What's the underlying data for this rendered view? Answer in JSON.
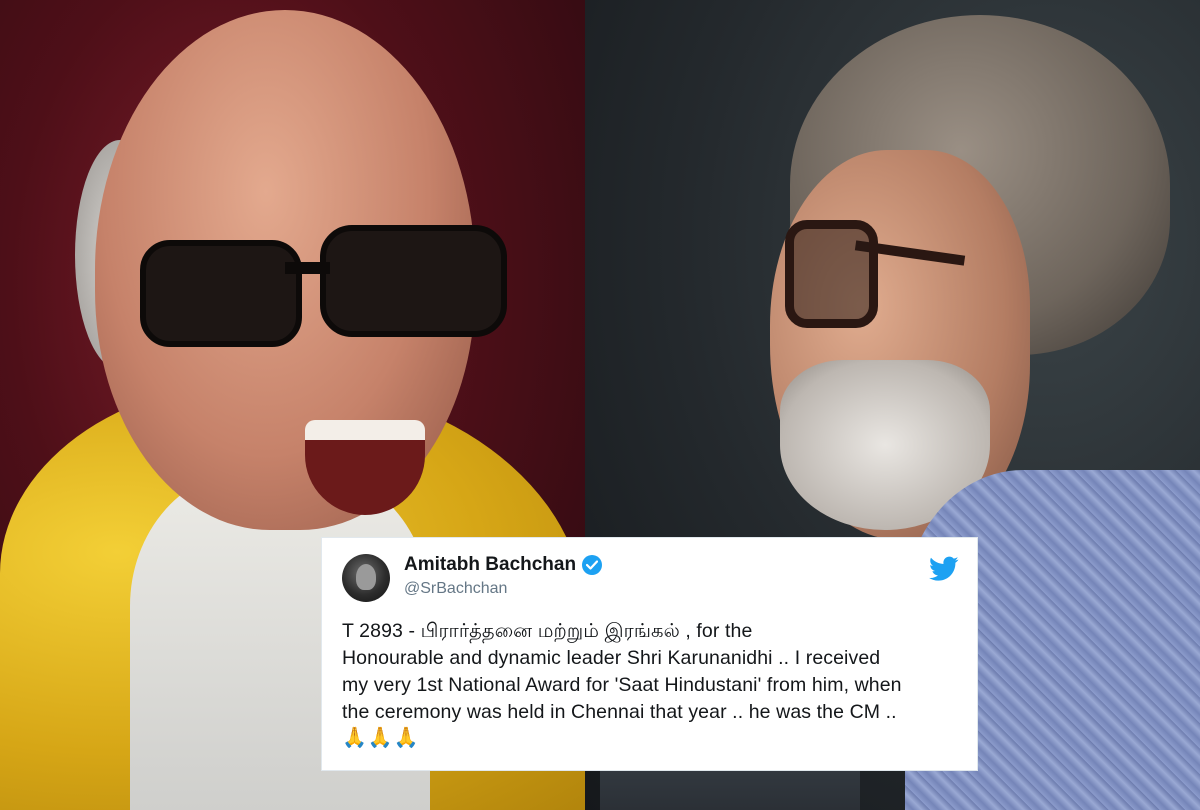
{
  "tweet": {
    "display_name": "Amitabh Bachchan",
    "handle": "@SrBachchan",
    "text": "T 2893 -  பிரார்த்தனை மற்றும் இரங்கல் , for the\nHonourable and dynamic leader Shri Karunanidhi .. I received\nmy very 1st National Award for 'Saat Hindustani' from him, when\nthe ceremony was held in Chennai that year .. he was the CM ..",
    "emoji": "🙏🙏🙏",
    "verified": true
  },
  "icons": {
    "verified": "verified-badge-icon",
    "platform": "twitter-bird-icon"
  },
  "colors": {
    "twitter_blue": "#1da1f2",
    "shawl_yellow": "#e0b01e",
    "left_background": "#5a111b",
    "kurta_blue": "#8190c2"
  }
}
